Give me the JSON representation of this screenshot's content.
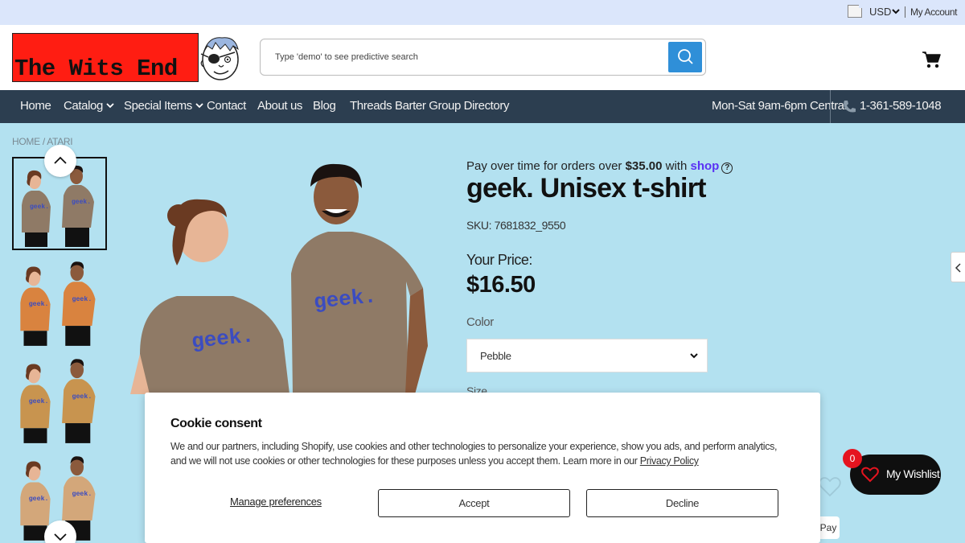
{
  "topbar": {
    "currency": "USD",
    "account_label": "My Account"
  },
  "header": {
    "logo_text": "The Wits End",
    "search_placeholder": "Type 'demo' to see predictive search"
  },
  "nav": {
    "items": [
      "Home",
      "Catalog",
      "Special Items",
      "Contact",
      "About us",
      "Blog",
      "Threads Barter Group Directory"
    ],
    "hours": "Mon-Sat 9am-6pm Central",
    "phone": "1-361-589-1048"
  },
  "breadcrumb": "HOME / ATARI",
  "product": {
    "payover_prefix": "Pay over time for orders over ",
    "payover_amount": "$35.00",
    "payover_with": " with ",
    "payover_brand": "shop",
    "title": "geek. Unisex t-shirt",
    "sku": "SKU: 7681832_9550",
    "your_price_label": "Your Price:",
    "price": "$16.50",
    "color_label": "Color",
    "color_value": "Pebble",
    "size_label": "Size",
    "shirt_text": "geek."
  },
  "thumbnails": {
    "colors": [
      "#8f7a66",
      "#d9833f",
      "#c8944f",
      "#d3a77a"
    ]
  },
  "wishlist": {
    "label": "My Wishlist",
    "count": "0"
  },
  "gpay_label": "Pay",
  "cookie": {
    "title": "Cookie consent",
    "text": "We and our partners, including Shopify, use cookies and other technologies to personalize your experience, show you ads, and perform analytics, and we will not use cookies or other technologies for these purposes unless you accept them. Learn more in our ",
    "privacy_link": "Privacy Policy",
    "manage_label": "Manage preferences",
    "accept_label": "Accept",
    "decline_label": "Decline"
  }
}
